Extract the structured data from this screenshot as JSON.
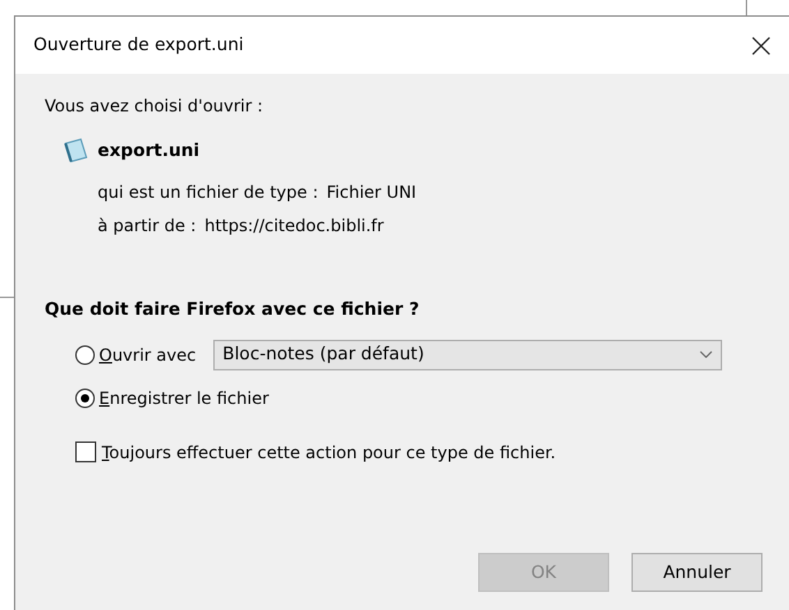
{
  "dialog": {
    "title": "Ouverture de export.uni",
    "intro": "Vous avez choisi d'ouvrir :",
    "file": {
      "name": "export.uni",
      "type_label": "qui est un fichier de type :",
      "type_value": "Fichier UNI",
      "from_label": "à partir de :",
      "from_value": "https://citedoc.bibli.fr"
    },
    "question": "Que doit faire Firefox avec ce fichier ?",
    "options": [
      {
        "label": "Ouvrir avec",
        "selected": false,
        "kind": "with-app",
        "app": "Bloc-notes (par défaut)"
      },
      {
        "label": "Enregistrer le fichier",
        "selected": true,
        "kind": "plain"
      }
    ],
    "always": {
      "label": "Toujours effectuer cette action pour ce type de fichier.",
      "checked": false
    },
    "buttons": [
      {
        "label": "OK",
        "disabled": true
      },
      {
        "label": "Annuler",
        "disabled": false
      }
    ]
  }
}
